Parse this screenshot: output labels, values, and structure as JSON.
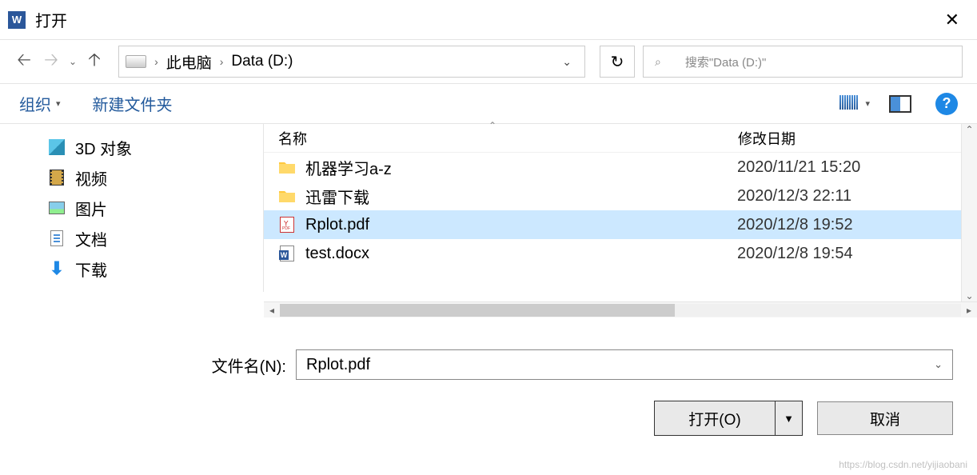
{
  "window": {
    "title": "打开"
  },
  "breadcrumb": {
    "items": [
      "此电脑",
      "Data (D:)"
    ]
  },
  "search": {
    "placeholder": "搜索\"Data (D:)\""
  },
  "toolbar": {
    "organize": "组织",
    "new_folder": "新建文件夹"
  },
  "sidebar": {
    "items": [
      {
        "label": "3D 对象",
        "icon": "3d"
      },
      {
        "label": "视频",
        "icon": "video"
      },
      {
        "label": "图片",
        "icon": "pic"
      },
      {
        "label": "文档",
        "icon": "doc"
      },
      {
        "label": "下载",
        "icon": "dl"
      }
    ]
  },
  "columns": {
    "name": "名称",
    "date": "修改日期"
  },
  "files": [
    {
      "name": "机器学习a-z",
      "date": "2020/11/21 15:20",
      "type": "folder",
      "selected": false
    },
    {
      "name": "迅雷下载",
      "date": "2020/12/3 22:11",
      "type": "folder",
      "selected": false
    },
    {
      "name": "Rplot.pdf",
      "date": "2020/12/8 19:52",
      "type": "pdf",
      "selected": true
    },
    {
      "name": "test.docx",
      "date": "2020/12/8 19:54",
      "type": "word",
      "selected": false
    }
  ],
  "filename": {
    "label": "文件名(N):",
    "value": "Rplot.pdf"
  },
  "buttons": {
    "open": "打开(O)",
    "cancel": "取消"
  },
  "watermark": "https://blog.csdn.net/yijiaobani"
}
